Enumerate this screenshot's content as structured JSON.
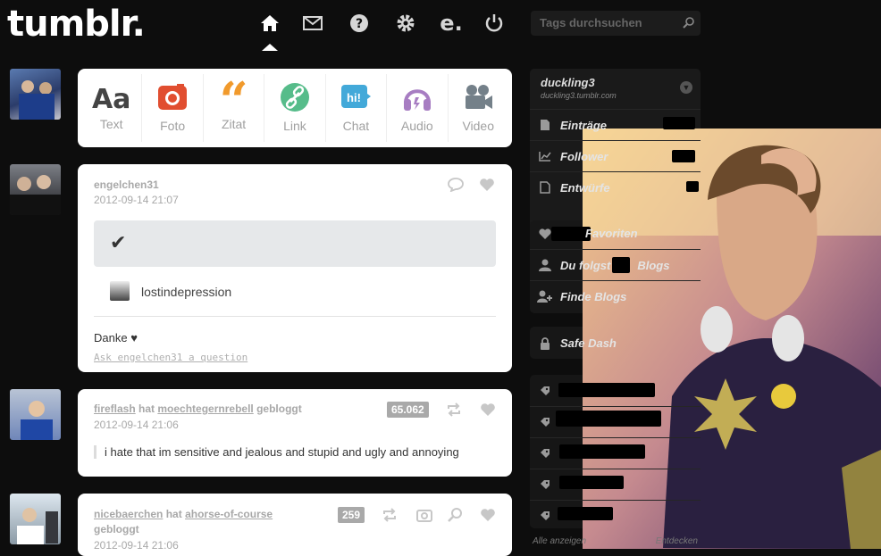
{
  "brand": {
    "logo": "tumblr."
  },
  "nav": {
    "icons": [
      "home-icon",
      "mail-icon",
      "help-icon",
      "gear-icon",
      "e-icon",
      "power-icon"
    ]
  },
  "search": {
    "placeholder": "Tags durchsuchen"
  },
  "composer": {
    "types": [
      {
        "label": "Text",
        "glyph": "Aa",
        "color": "#444444"
      },
      {
        "label": "Foto",
        "glyph": "▣",
        "color": "#e14e30"
      },
      {
        "label": "Zitat",
        "glyph": "“",
        "color": "#f19a2c"
      },
      {
        "label": "Link",
        "glyph": "∞",
        "color": "#56bc8a"
      },
      {
        "label": "Chat",
        "glyph": "hi!",
        "color": "#43a9d9"
      },
      {
        "label": "Audio",
        "glyph": "☊",
        "color": "#a77dc2"
      },
      {
        "label": "Video",
        "glyph": "■",
        "color": "#748089"
      }
    ]
  },
  "posts": [
    {
      "blog": "engelchen31",
      "date": "2012-09-14 21:07",
      "answer_mark": "✔",
      "asker": "lostindepression",
      "body": "Danke ♥",
      "ask_link": "Ask engelchen31 a question"
    },
    {
      "blog": "fireflash",
      "verb": "hat",
      "source": "moechtegernrebell",
      "action": "gebloggt",
      "notes": "65.062",
      "date": "2012-09-14 21:06",
      "quote": "i hate that im sensitive and jealous and stupid and ugly and annoying"
    },
    {
      "blog": "nicebaerchen",
      "verb": "hat",
      "source": "ahorse-of-course",
      "action": "gebloggt",
      "notes": "259",
      "date": "2012-09-14 21:06"
    }
  ],
  "sidebar": {
    "blog_title": "duckling3",
    "blog_url": "duckling3.tumblr.com",
    "rows": [
      {
        "label": "Einträge",
        "icon": "document-icon"
      },
      {
        "label": "Follower",
        "icon": "chart-icon"
      },
      {
        "label": "Entwürfe",
        "icon": "draft-icon"
      }
    ],
    "rows2": [
      {
        "label": "Favoriten",
        "icon": "heart-icon"
      },
      {
        "label": "Du folgst",
        "suffix": "Blogs",
        "icon": "person-icon"
      },
      {
        "label": "Finde Blogs",
        "icon": "person-add-icon"
      }
    ],
    "safe_dash": "Safe Dash",
    "footer_left": "Alle anzeigen",
    "footer_right": "Entdecken"
  },
  "colors": {
    "background": "#0d0d0d",
    "card": "#ffffff",
    "sidebar_box": "#1a1a1a"
  }
}
